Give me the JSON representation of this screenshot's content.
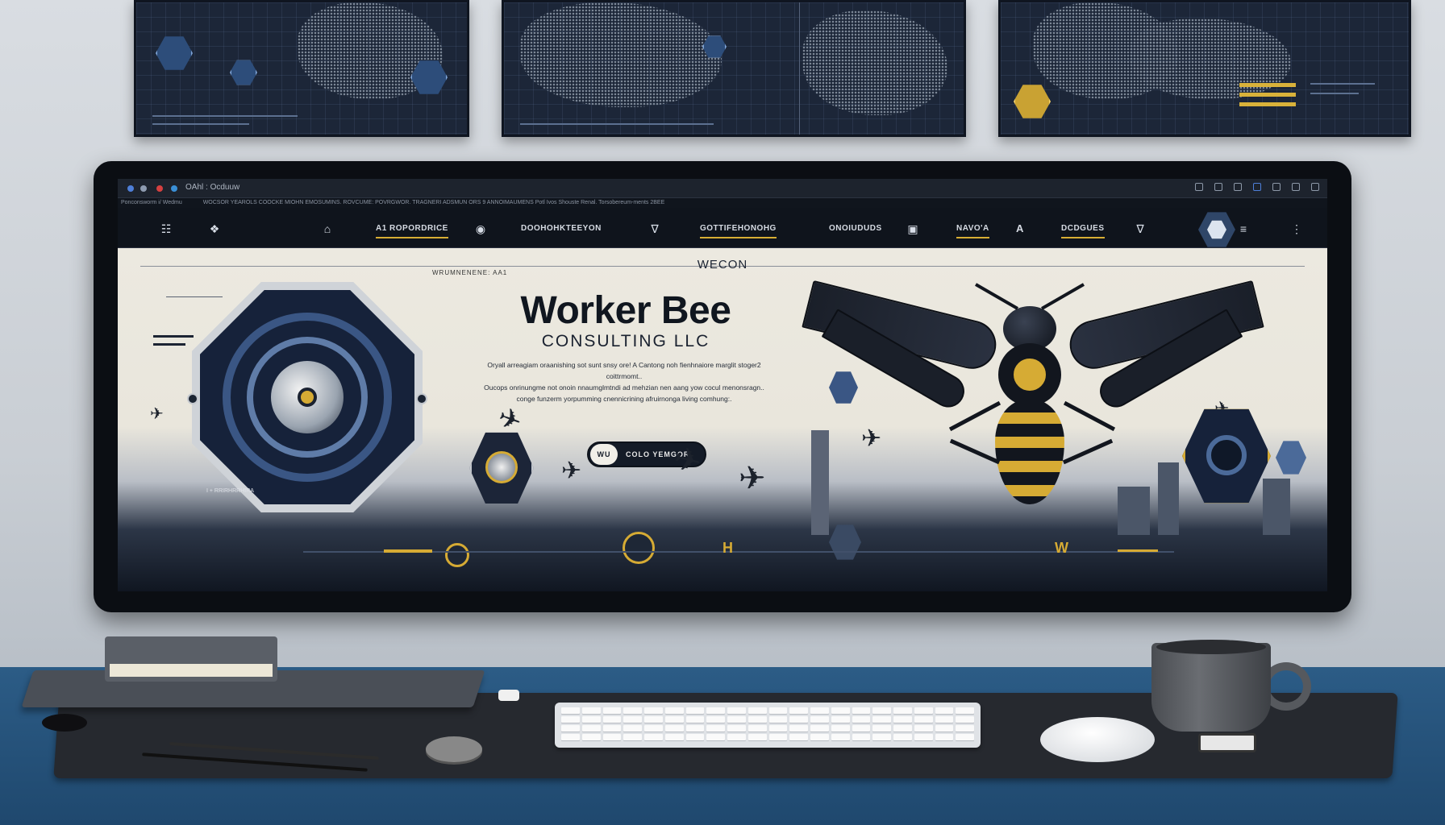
{
  "browser": {
    "tab_label": "OAhl : Ocduuw",
    "ticker": [
      "Ponconsworm i/ Wedmu",
      "WOCSOR YEAROLS COOCKE MIOHN EMOSUMINS. ROVCUME: POVRGWOR. TRAGNERI ADSMUN ORS 9 ANNOIMAUMENS Potl Ivos Shouste Renal. Torsobereum-ments 2BEE"
    ]
  },
  "nav": {
    "items": [
      {
        "label": "A1 ROPORDRICE",
        "active": true
      },
      {
        "label": "DOOHOHKTEEYON",
        "active": false
      },
      {
        "label": "GOTTIFEHONOHG",
        "active": true
      },
      {
        "label": "ONOIUDUDS",
        "active": false
      },
      {
        "label": "NAVO'A",
        "active": true
      },
      {
        "label": "A",
        "active": false
      },
      {
        "label": "DCDGUES",
        "active": true
      }
    ]
  },
  "hero": {
    "eyebrow": "WECON",
    "small_tag": "WRUMNENENE: AA1",
    "title": "Worker Bee",
    "subtitle": "CONSULTING LLC",
    "body_lines": [
      "Oryall arreagiam oraanishing sot sunt snsy ore! A Cantong noh fienhnaiore marglit stoger2 coittrmomt..",
      "Oucops onrinungme not onoin nnaumglmtndi ad mehzian nen aang yow cocul menonsragn..",
      "conge funzerm yorpumming cnennicrining afruirnonga living comhung:."
    ],
    "cta_pill": "WU",
    "cta_label": "COLO YEMGOR",
    "side_label": "I + RRIRHRRHIRA",
    "footer_marks": [
      "H",
      "W"
    ]
  },
  "colors": {
    "accent_gold": "#d6ab34",
    "navy": "#16223a",
    "hero_bg": "#ece9e0",
    "desk_blue": "#2c5c86"
  },
  "icons": [
    "home-icon",
    "network-icon",
    "shield-icon",
    "hexagon-logo-icon",
    "menu-icon"
  ]
}
